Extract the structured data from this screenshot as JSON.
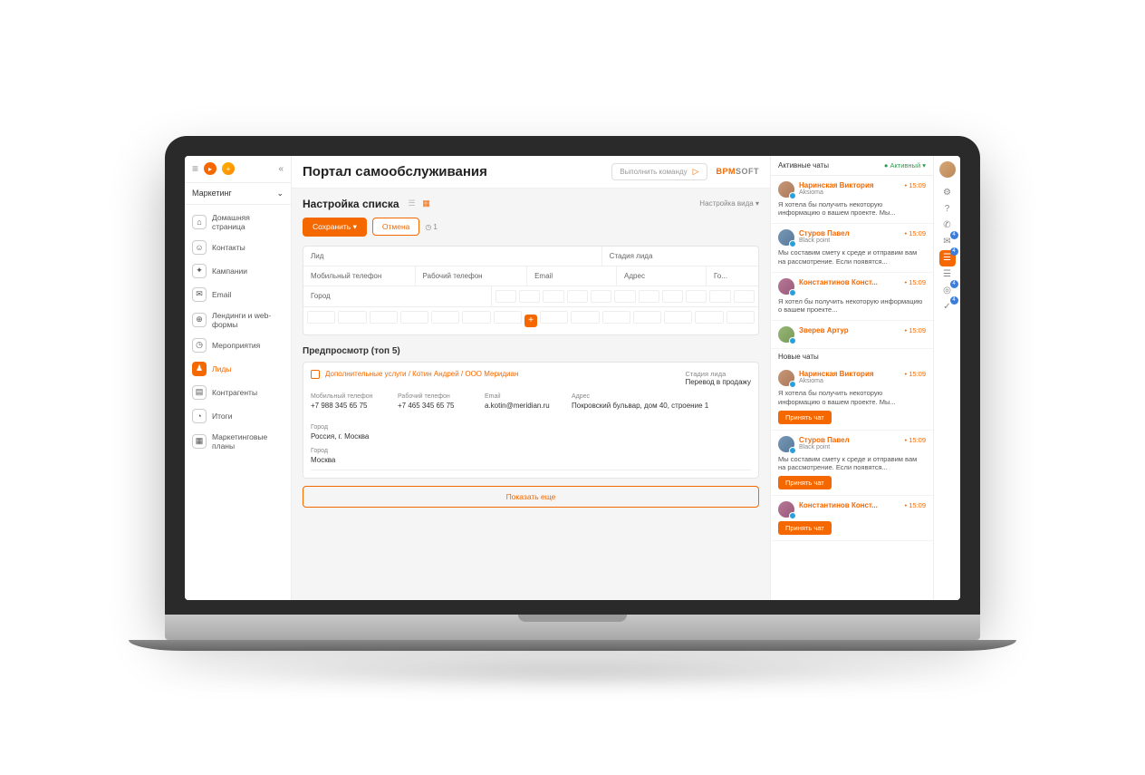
{
  "sidebar": {
    "section": "Маркетинг",
    "items": [
      {
        "icon": "⌂",
        "label": "Домашняя страница"
      },
      {
        "icon": "☺",
        "label": "Контакты"
      },
      {
        "icon": "✦",
        "label": "Кампании"
      },
      {
        "icon": "✉",
        "label": "Email"
      },
      {
        "icon": "⊕",
        "label": "Лендинги и web-формы"
      },
      {
        "icon": "◷",
        "label": "Мероприятия"
      },
      {
        "icon": "♟",
        "label": "Лиды",
        "active": true
      },
      {
        "icon": "▤",
        "label": "Контрагенты"
      },
      {
        "icon": "◔",
        "label": "Итоги"
      },
      {
        "icon": "▦",
        "label": "Маркетинговые планы"
      }
    ]
  },
  "header": {
    "title": "Портал самообслуживания",
    "command_placeholder": "Выполнить команду",
    "brand1": "BPM",
    "brand2": "SOFT"
  },
  "listSetup": {
    "title": "Настройка списка",
    "viewSetup": "Настройка вида",
    "save": "Сохранить",
    "cancel": "Отмена",
    "timer": "1",
    "columns": {
      "lead": "Лид",
      "stage": "Стадия лида",
      "mobile": "Мобильный телефон",
      "work": "Рабочий телефон",
      "email": "Email",
      "address": "Адрес",
      "go": "Го...",
      "city": "Город"
    }
  },
  "preview": {
    "title": "Предпросмотр (топ 5)",
    "lead_name": "Дополнительные услуги / Котин Андрей / ООО Меридиан",
    "stage_label": "Стадия лида",
    "stage_value": "Перевод в продажу",
    "fields": [
      {
        "label": "Мобильный телефон",
        "value": "+7 988 345 65 75"
      },
      {
        "label": "Рабочий телефон",
        "value": "+7 465 345 65 75"
      },
      {
        "label": "Email",
        "value": "a.kotin@meridian.ru"
      },
      {
        "label": "Адрес",
        "value": "Покровский бульвар, дом 40, строение 1"
      },
      {
        "label": "Город",
        "value": "Россия, г. Москва"
      }
    ],
    "city_label": "Город",
    "city_value": "Москва",
    "show_more": "Показать еще"
  },
  "chats": {
    "title": "Активные чаты",
    "status": "Активный",
    "new_label": "Новые чаты",
    "accept": "Принять чат",
    "active": [
      {
        "name": "Наринская Виктория",
        "sub": "Aksioma",
        "time": "• 15:09",
        "msg": "Я хотела бы получить некоторую информацию о вашем проекте. Мы...",
        "ava": "a1"
      },
      {
        "name": "Стуров Павел",
        "sub": "Black point",
        "time": "• 15:09",
        "msg": "Мы составим смету к среде и отправим вам на рассмотрение. Если появятся...",
        "ava": "a2"
      },
      {
        "name": "Константинов Конст...",
        "sub": "",
        "time": "• 15:09",
        "msg": "Я хотел бы получить некоторую информацию о вашем проекте...",
        "ava": "a3"
      },
      {
        "name": "Зверев Артур",
        "sub": "",
        "time": "• 15:09",
        "msg": "",
        "ava": "a4"
      }
    ],
    "new": [
      {
        "name": "Наринская Виктория",
        "sub": "Aksioma",
        "time": "• 15:09",
        "msg": "Я хотела бы получить некоторую информацию о вашем проекте. Мы...",
        "ava": "a1"
      },
      {
        "name": "Стуров Павел",
        "sub": "Black point",
        "time": "• 15:09",
        "msg": "Мы составим смету к среде и отправим вам на рассмотрение. Если появятся...",
        "ava": "a2"
      },
      {
        "name": "Константинов Конст...",
        "sub": "",
        "time": "• 15:09",
        "msg": "",
        "ava": "a3"
      }
    ]
  },
  "rail": [
    {
      "icon": "⚙",
      "name": "settings-icon"
    },
    {
      "icon": "?",
      "name": "help-icon"
    },
    {
      "icon": "✆",
      "name": "phone-icon"
    },
    {
      "icon": "✉",
      "name": "mail-icon",
      "badge": "4"
    },
    {
      "icon": "☰",
      "name": "feed-icon"
    },
    {
      "icon": "◎",
      "name": "bell-icon",
      "badge": "4"
    },
    {
      "icon": "✓",
      "name": "tasks-icon",
      "badge": "4"
    }
  ]
}
